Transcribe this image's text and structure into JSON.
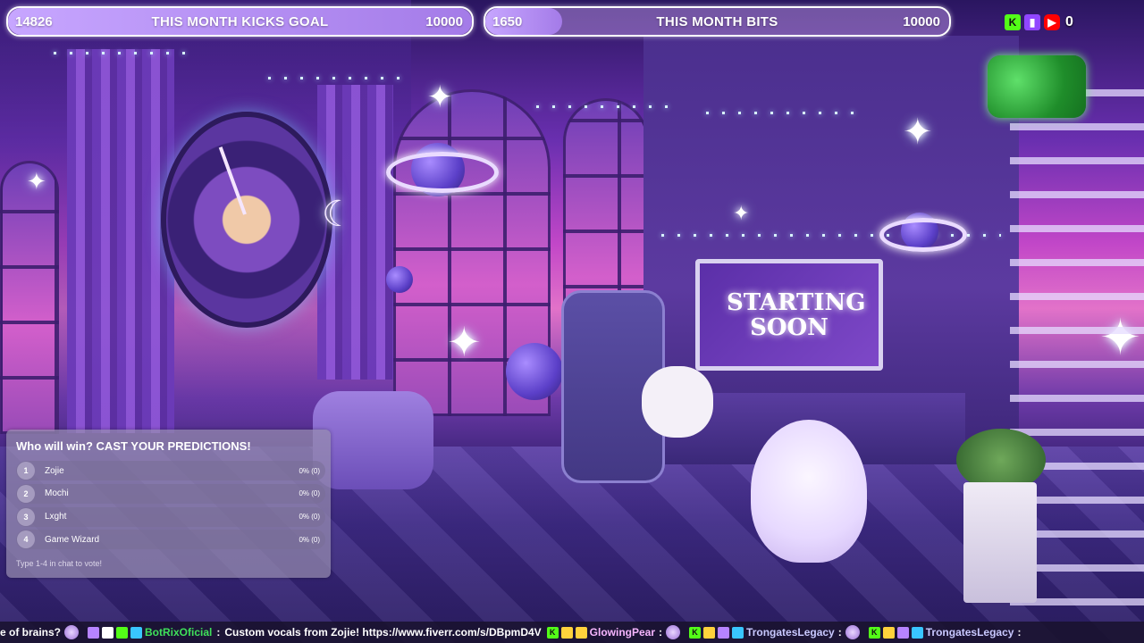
{
  "goals": [
    {
      "id": "kicks",
      "current": "14826",
      "title": "THIS MONTH KICKS GOAL",
      "target": "10000",
      "progress": 1.0
    },
    {
      "id": "bits",
      "current": "1650",
      "title": "THIS MONTH BITS",
      "target": "10000",
      "progress": 0.165
    }
  ],
  "platforms": {
    "icons": [
      "kick-icon",
      "twitch-icon",
      "youtube-icon"
    ],
    "viewer_count": "0",
    "colors": {
      "kick": "#53fc18",
      "twitch": "#9146ff",
      "youtube": "#ff0000"
    }
  },
  "scene": {
    "monitor_text_line1": "STARTING",
    "monitor_text_line2": "SOON"
  },
  "poll": {
    "title": "Who will win? CAST YOUR PREDICTIONS!",
    "options": [
      {
        "num": "1",
        "label": "Zojie",
        "stat": "0% (0)"
      },
      {
        "num": "2",
        "label": "Mochi",
        "stat": "0% (0)"
      },
      {
        "num": "3",
        "label": "Lxght",
        "stat": "0% (0)"
      },
      {
        "num": "4",
        "label": "Game Wizard",
        "stat": "0% (0)"
      }
    ],
    "footer": "Type 1-4 in chat to vote!"
  },
  "ticker": {
    "msg1_text": "e of brains?",
    "msg2_user": "BotRixOficial",
    "msg2_sep": ":",
    "msg2_text": "Custom vocals from Zojie! https://www.fiverr.com/s/DBpmD4V",
    "msg3_user": "GlowingPear",
    "msg3_sep": ":",
    "msg4_user": "TrongatesLegacy",
    "msg4_sep": ":",
    "msg5_user": "TrongatesLegacy",
    "msg5_sep": ":"
  }
}
